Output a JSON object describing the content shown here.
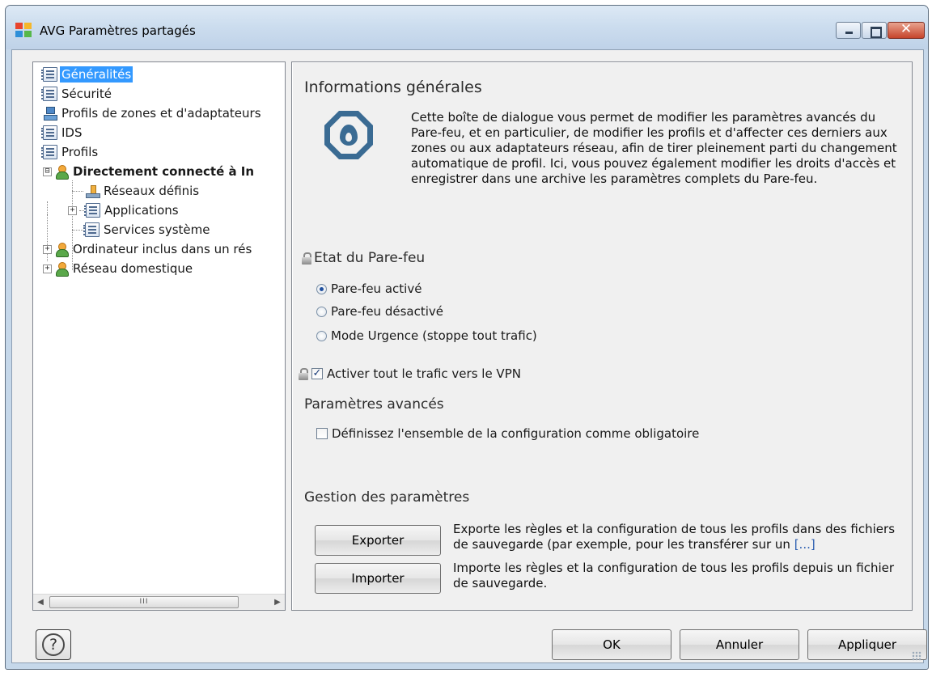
{
  "window": {
    "title": "AVG Paramètres partagés",
    "close_glyph": "✕"
  },
  "tree": {
    "items": [
      {
        "label": "Généralités",
        "icon": "document-icon",
        "selected": true
      },
      {
        "label": "Sécurité",
        "icon": "document-icon"
      },
      {
        "label": "Profils de zones et d'adaptateurs",
        "icon": "network-icon"
      },
      {
        "label": "IDS",
        "icon": "document-icon"
      },
      {
        "label": "Profils",
        "icon": "document-icon"
      },
      {
        "label": "Directement connecté à In",
        "icon": "user-profile-icon",
        "expander": "⊟",
        "bold": true
      },
      {
        "label": "Réseaux définis",
        "icon": "network-adapter-icon"
      },
      {
        "label": "Applications",
        "icon": "document-icon",
        "expander": "+"
      },
      {
        "label": "Services système",
        "icon": "document-icon"
      },
      {
        "label": "Ordinateur inclus dans un rés",
        "icon": "user-profile-icon",
        "expander": "+"
      },
      {
        "label": "Réseau domestique",
        "icon": "user-profile-icon",
        "expander": "+"
      }
    ],
    "scroll_thumb_grip": "III",
    "scroll_left": "◀",
    "scroll_right": "▶"
  },
  "content": {
    "section_title": "Informations générales",
    "description": "Cette boîte de dialogue vous permet de modifier les paramètres avancés du Pare-feu, et en particulier, de modifier les profils et d'affecter ces derniers aux zones ou aux adaptateurs réseau, afin de tirer pleinement parti du changement automatique de profil. Ici, vous pouvez également modifier les droits d'accès et enregistrer dans une archive les paramètres complets du Pare-feu.",
    "firewall_state": {
      "title": "Etat du Pare-feu",
      "options": [
        {
          "label": "Pare-feu activé",
          "checked": true
        },
        {
          "label": "Pare-feu désactivé",
          "checked": false
        },
        {
          "label": "Mode Urgence (stoppe tout trafic)",
          "checked": false
        }
      ]
    },
    "vpn": {
      "label": "Activer tout le trafic vers le VPN",
      "checked": true,
      "check_glyph": "✓"
    },
    "advanced": {
      "title": "Paramètres avancés",
      "mandatory_label": "Définissez l'ensemble de la configuration comme obligatoire",
      "mandatory_checked": false
    },
    "management": {
      "title": "Gestion des paramètres",
      "export_label": "Exporter",
      "export_desc": "Exporte les règles et la configuration de tous les profils dans des fichiers de sauvegarde (par exemple, pour les transférer sur un",
      "export_more": "[...]",
      "import_label": "Importer",
      "import_desc": "Importe les règles et la configuration de tous les profils depuis un fichier de sauvegarde."
    }
  },
  "footer": {
    "help_glyph": "?",
    "ok_label": "OK",
    "cancel_label": "Annuler",
    "apply_label": "Appliquer"
  }
}
